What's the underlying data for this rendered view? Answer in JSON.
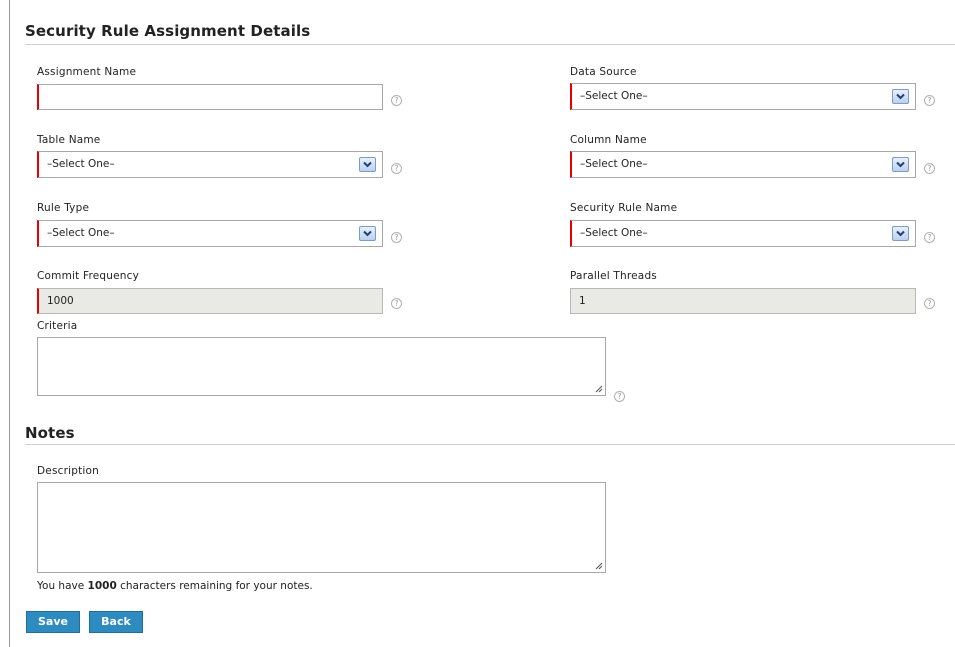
{
  "sections": {
    "details_title": "Security Rule Assignment Details",
    "notes_title": "Notes"
  },
  "fields": {
    "assignment_name": {
      "label": "Assignment Name",
      "value": ""
    },
    "data_source": {
      "label": "Data Source",
      "value": "–Select One–"
    },
    "table_name": {
      "label": "Table Name",
      "value": "–Select One–"
    },
    "column_name": {
      "label": "Column Name",
      "value": "–Select One–"
    },
    "rule_type": {
      "label": "Rule Type",
      "value": "–Select One–"
    },
    "security_rule_name": {
      "label": "Security Rule Name",
      "value": "–Select One–"
    },
    "commit_frequency": {
      "label": "Commit Frequency",
      "value": "1000"
    },
    "parallel_threads": {
      "label": "Parallel Threads",
      "value": "1"
    },
    "criteria": {
      "label": "Criteria",
      "value": ""
    },
    "description": {
      "label": "Description",
      "value": ""
    }
  },
  "help_icon_glyph": "?",
  "notes_remaining": {
    "prefix": "You have ",
    "count": "1000",
    "suffix": " characters remaining for your notes."
  },
  "buttons": {
    "save": "Save",
    "back": "Back"
  },
  "colors": {
    "required_marker": "#e60000",
    "button_bg": "#2d8bc0",
    "disabled_bg": "#e9e9e5"
  }
}
